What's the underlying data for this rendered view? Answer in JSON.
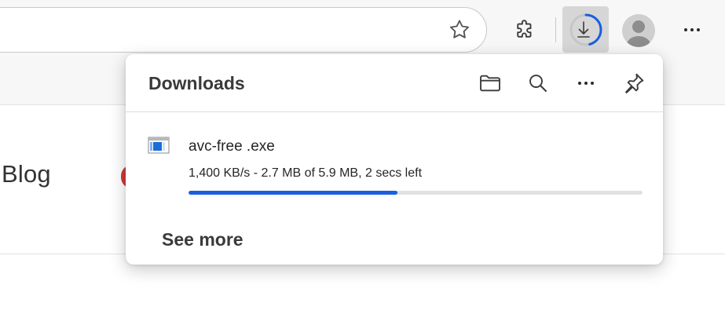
{
  "toolbar": {
    "icons": {
      "favorite": "star-outline-icon",
      "extensions": "puzzle-piece-icon",
      "downloads": "download-arrow-icon",
      "profile": "person-avatar-icon",
      "more": "ellipsis-icon"
    },
    "download_ring_progress": 0.46,
    "accent_color": "#1a5fde"
  },
  "page": {
    "blog_link": "Blog"
  },
  "downloads_flyout": {
    "title": "Downloads",
    "header_icons": [
      "folder-icon",
      "search-icon",
      "more-options-icon",
      "pin-icon"
    ],
    "items": [
      {
        "file_name": "avc-free .exe",
        "status": "1,400 KB/s - 2.7 MB of 5.9 MB, 2 secs left",
        "progress": 0.46
      }
    ],
    "see_more": "See more"
  }
}
